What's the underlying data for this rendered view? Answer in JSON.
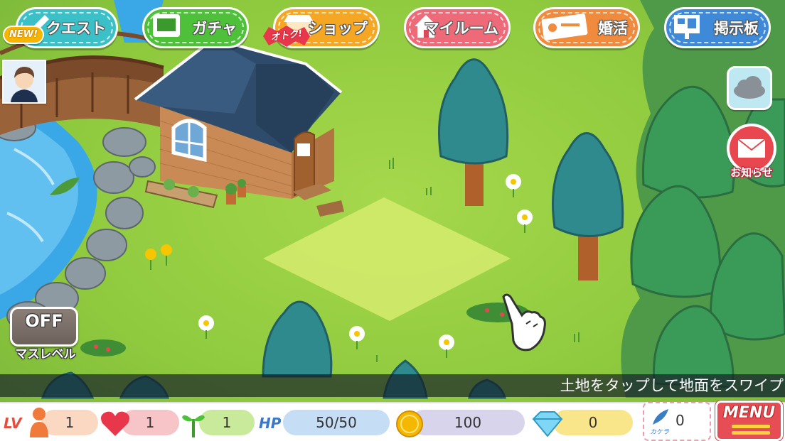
{
  "nav": {
    "quest": "クエスト",
    "quest_badge": "NEW!",
    "gacha": "ガチャ",
    "shop": "ショップ",
    "shop_badge": "オトク!",
    "myroom": "マイルーム",
    "konkatsu": "婚活",
    "board": "掲示板"
  },
  "side": {
    "notice_label": "お知らせ",
    "masu_state": "OFF",
    "masu_label": "マスレベル"
  },
  "hint": {
    "text": "土地をタップして地面をスワイプ"
  },
  "status": {
    "lv_label": "LV",
    "lv_value": "1",
    "heart_value": "1",
    "sprout_value": "1",
    "hp_label": "HP",
    "hp_value": "50/50",
    "coin_value": "100",
    "diamond_value": "0",
    "kakera_label": "カケラ",
    "kakera_value": "0",
    "menu_label": "MENU"
  },
  "colors": {
    "quest": "#3cc0c8",
    "gacha": "#4fc03a",
    "shop": "#f5a623",
    "myroom": "#ef6a78",
    "konkatsu": "#f08a3c",
    "board": "#3e8ad8",
    "grass": "#8fca3e"
  }
}
